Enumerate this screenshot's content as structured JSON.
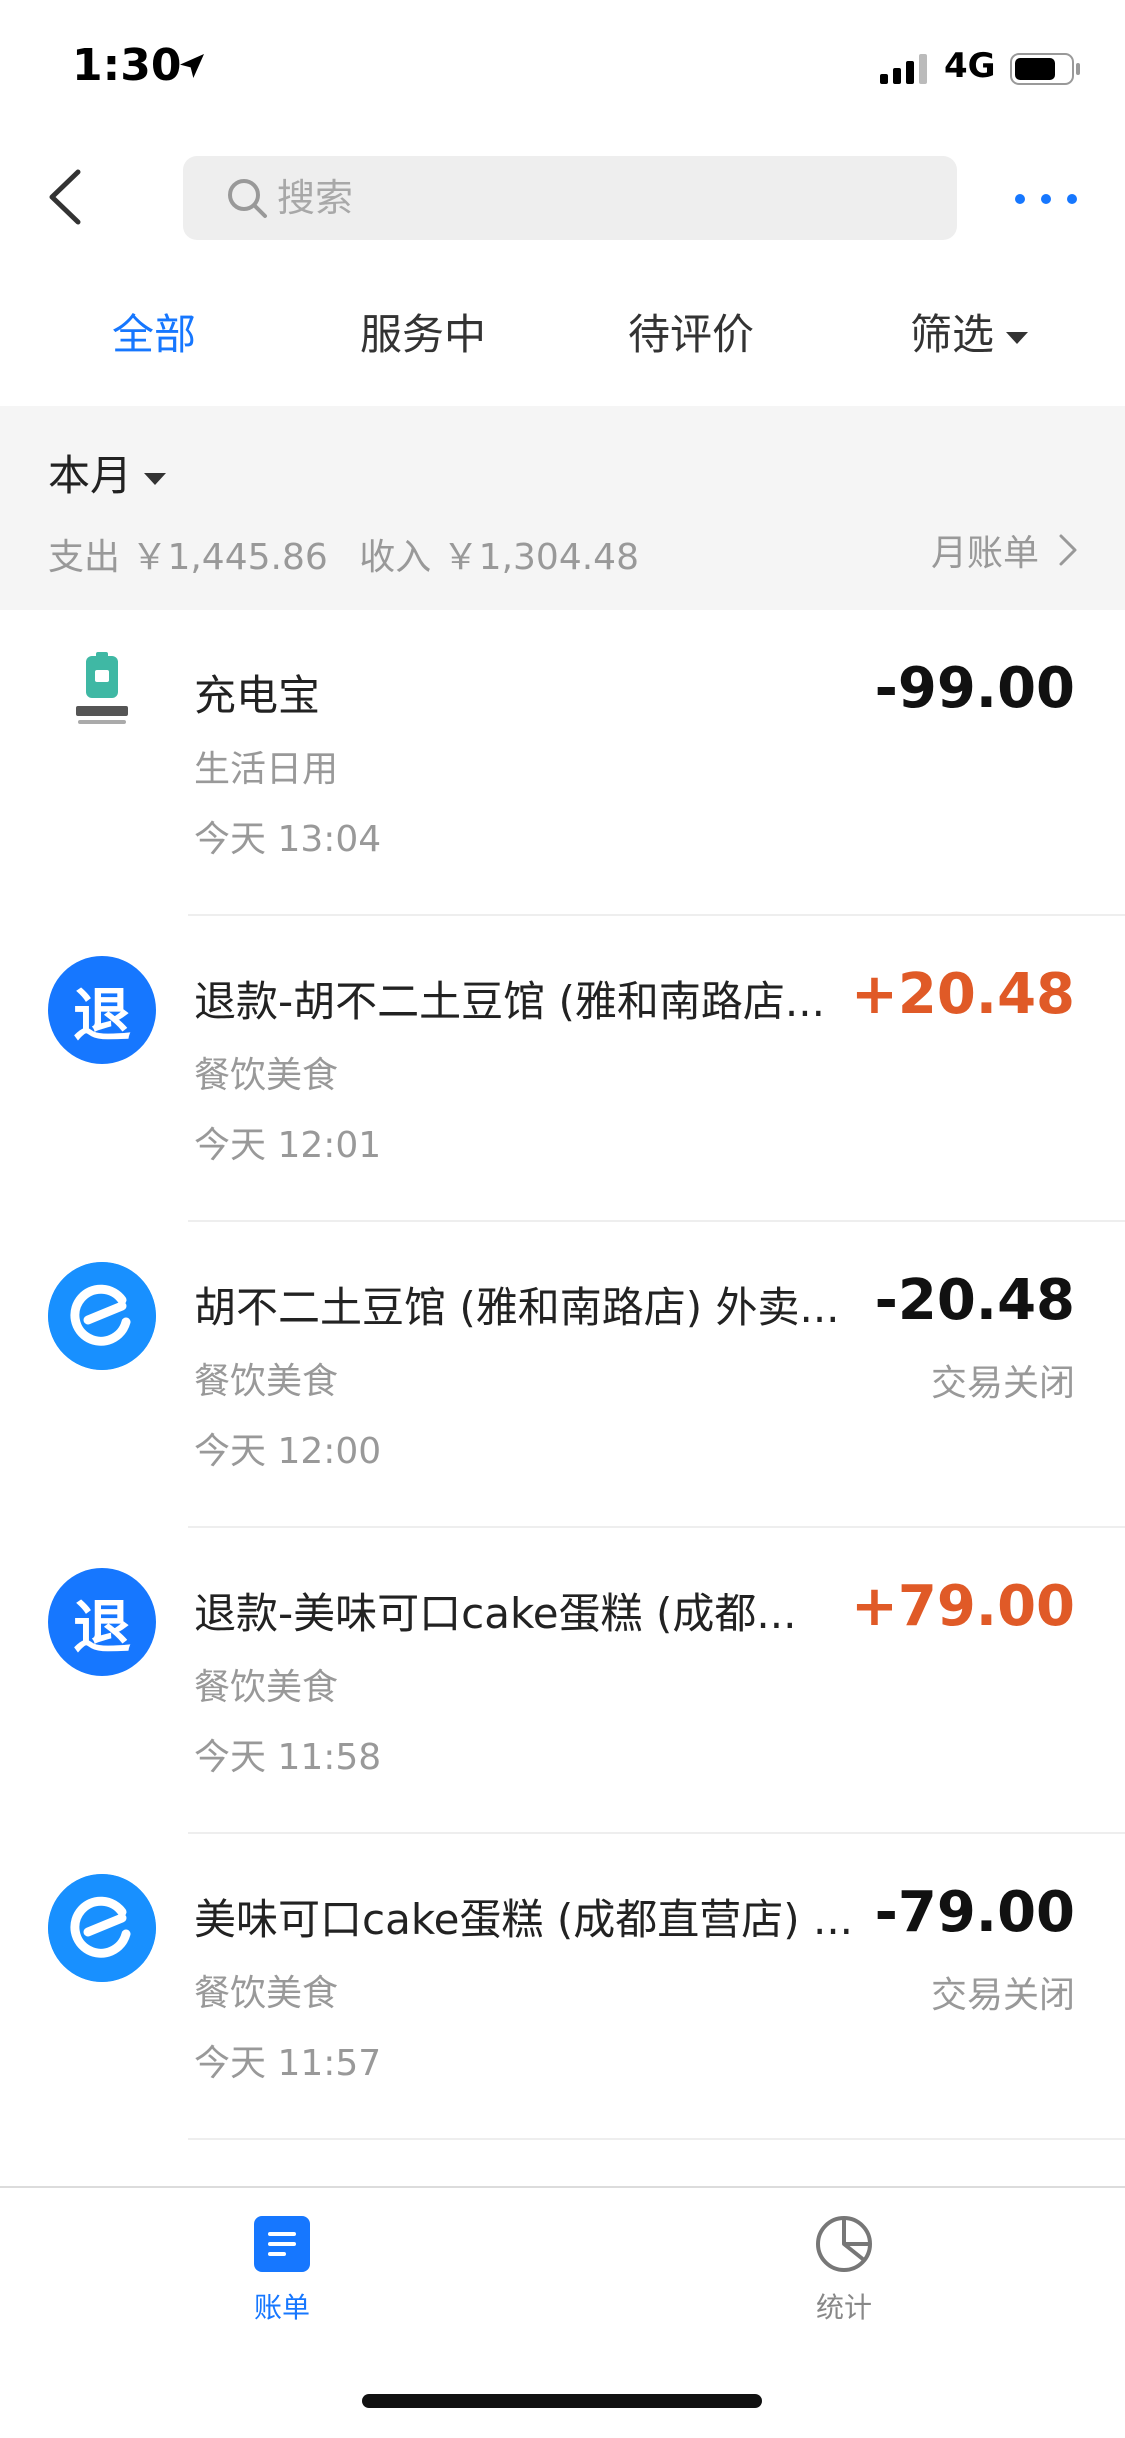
{
  "status_bar": {
    "time": "1:30",
    "network": "4G"
  },
  "search": {
    "placeholder": "搜索"
  },
  "tabs": [
    {
      "label": "全部"
    },
    {
      "label": "服务中"
    },
    {
      "label": "待评价"
    },
    {
      "label": "筛选"
    }
  ],
  "summary": {
    "month_label": "本月",
    "expense": "支出 ￥1,445.86",
    "income": "收入 ￥1,304.48",
    "month_bill_link": "月账单"
  },
  "transactions": [
    {
      "icon": "power-bank-logo",
      "title": "充电宝",
      "category": "生活日用",
      "time": "今天 13:04",
      "amount": "-99.00",
      "status": ""
    },
    {
      "icon": "refund-icon",
      "avatar_text": "退",
      "title": "退款-胡不二土豆馆 (雅和南路店...",
      "category": "餐饮美食",
      "time": "今天 12:01",
      "amount": "+20.48",
      "status": ""
    },
    {
      "icon": "eleme-icon",
      "title": "胡不二土豆馆 (雅和南路店) 外卖...",
      "category": "餐饮美食",
      "time": "今天 12:00",
      "amount": "-20.48",
      "status": "交易关闭"
    },
    {
      "icon": "refund-icon",
      "avatar_text": "退",
      "title": "退款-美味可口cake蛋糕 (成都...",
      "category": "餐饮美食",
      "time": "今天 11:58",
      "amount": "+79.00",
      "status": ""
    },
    {
      "icon": "eleme-icon",
      "title": "美味可口cake蛋糕 (成都直营店) ...",
      "category": "餐饮美食",
      "time": "今天 11:57",
      "amount": "-79.00",
      "status": "交易关闭"
    }
  ],
  "tab_bar": {
    "bill": "账单",
    "stats": "统计"
  },
  "colors": {
    "accent": "#1677ff",
    "income": "#e05a27",
    "muted": "#999999"
  }
}
